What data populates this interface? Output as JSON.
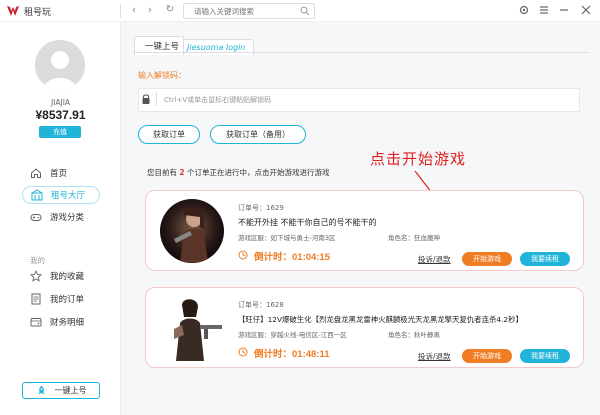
{
  "app": {
    "name": "租号玩",
    "search_placeholder": "请输入关键词搜索"
  },
  "sidebar": {
    "username": "JIAJIA",
    "balance": "¥8537.91",
    "recharge_label": "充值",
    "menu": [
      {
        "label": "首页",
        "icon": "home-icon"
      },
      {
        "label": "租号大厅",
        "icon": "hall-icon"
      },
      {
        "label": "游戏分类",
        "icon": "gamepad-icon"
      }
    ],
    "section_mine": "我的",
    "mine_menu": [
      {
        "label": "我的收藏",
        "icon": "star-icon"
      },
      {
        "label": "我的订单",
        "icon": "order-icon"
      },
      {
        "label": "财务明细",
        "icon": "finance-icon"
      }
    ],
    "quick_login_label": "一键上号"
  },
  "main": {
    "tab_cn": "一键上号",
    "tab_en": "Jiesuoma login",
    "code_label": "输入解锁码：",
    "code_placeholder": "Ctrl+V或单击鼠标右键粘贴解锁码",
    "btn_get_order": "获取订单",
    "btn_get_order_backup": "获取订单（备用）",
    "notice_prefix": "您目前有",
    "notice_count": "2",
    "notice_suffix": "个订单正在进行中，点击开始游戏进行游戏",
    "annotation": "点击开始游戏",
    "orders": [
      {
        "order_no": "订单号：1629",
        "title": "不能开外挂 不能干你自己的号不能干的",
        "region": "游戏区服：如下城与勇士-河南3区",
        "role": "角色名：狂血魔神",
        "countdown": "倒计时：01:04:15",
        "complain": "投诉/退款",
        "start": "开始游戏",
        "renew": "我要续租"
      },
      {
        "order_no": "订单号：1628",
        "title": "【旺仔】12V爆破生化【烈龙盘龙黑龙雷神火麒麟极光天龙黑龙擎天复仇者连杀4.2秒】",
        "region": "游戏区服：穿越火线-电信区-江西一区",
        "role": "角色名：秋叶静离",
        "countdown": "倒计时：01:48:11",
        "complain": "投诉/退款",
        "start": "开始游戏",
        "renew": "我要续租"
      }
    ]
  },
  "colors": {
    "accent": "#1fb4d8",
    "orange": "#f07c24",
    "red": "#e02020"
  }
}
